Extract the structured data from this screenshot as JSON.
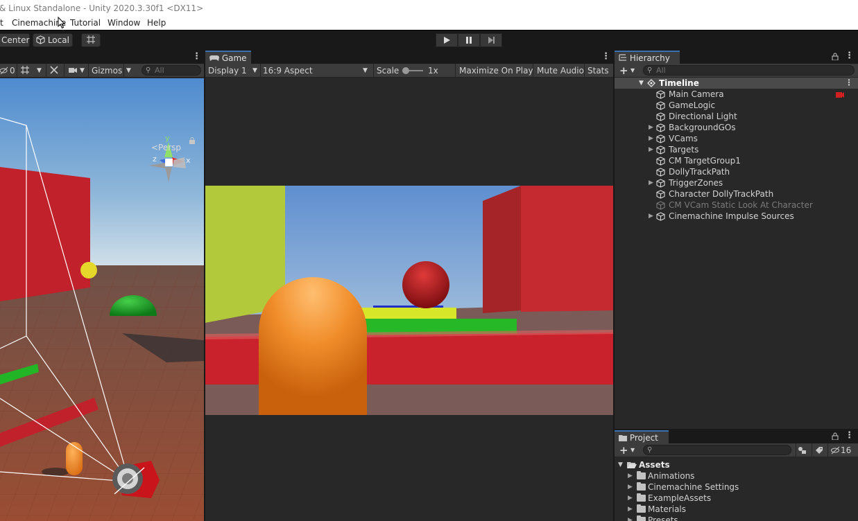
{
  "window": {
    "title": "& Linux Standalone - Unity 2020.3.30f1 <DX11>"
  },
  "menu": {
    "items": [
      "t",
      "Cinemachine",
      "Tutorial",
      "Window",
      "Help"
    ]
  },
  "toolbar": {
    "pivot_center": "Center",
    "pivot_local": "Local",
    "play_icon": "play-icon",
    "pause_icon": "pause-icon",
    "step_icon": "step-icon"
  },
  "scene": {
    "hidden_count": "0",
    "gizmos_label": "Gizmos",
    "search_placeholder": "All",
    "persp_label": "<Persp",
    "axis_y": "y",
    "axis_x": "x",
    "axis_z": "z"
  },
  "game": {
    "tab_label": "Game",
    "display": "Display 1",
    "aspect": "16:9 Aspect",
    "scale_label": "Scale",
    "scale_value": "1x",
    "scale_slider_fraction": 0.0,
    "maximize": "Maximize On Play",
    "mute": "Mute Audio",
    "stats": "Stats"
  },
  "hierarchy": {
    "tab_label": "Hierarchy",
    "search_placeholder": "All",
    "root": "Timeline",
    "items": [
      {
        "label": "Main Camera",
        "expandable": false,
        "dim": false
      },
      {
        "label": "GameLogic",
        "expandable": false,
        "dim": false
      },
      {
        "label": "Directional Light",
        "expandable": false,
        "dim": false
      },
      {
        "label": "BackgroundGOs",
        "expandable": true,
        "dim": false
      },
      {
        "label": "VCams",
        "expandable": true,
        "dim": false
      },
      {
        "label": "Targets",
        "expandable": true,
        "dim": false
      },
      {
        "label": "CM TargetGroup1",
        "expandable": false,
        "dim": false
      },
      {
        "label": "DollyTrackPath",
        "expandable": false,
        "dim": false
      },
      {
        "label": "TriggerZones",
        "expandable": true,
        "dim": false
      },
      {
        "label": "Character DollyTrackPath",
        "expandable": false,
        "dim": false
      },
      {
        "label": "CM VCam Static Look At Character",
        "expandable": false,
        "dim": true
      },
      {
        "label": "Cinemachine Impulse Sources",
        "expandable": true,
        "dim": false
      }
    ]
  },
  "project": {
    "tab_label": "Project",
    "hidden_count": "16",
    "root": "Assets",
    "folders": [
      "Animations",
      "Cinemachine Settings",
      "ExampleAssets",
      "Materials",
      "Presets"
    ]
  },
  "colors": {
    "accent": "#3a72b0",
    "panel_bg": "#282828",
    "toolbar_bg": "#3c3c3c",
    "camera_marker": "#d02020"
  }
}
